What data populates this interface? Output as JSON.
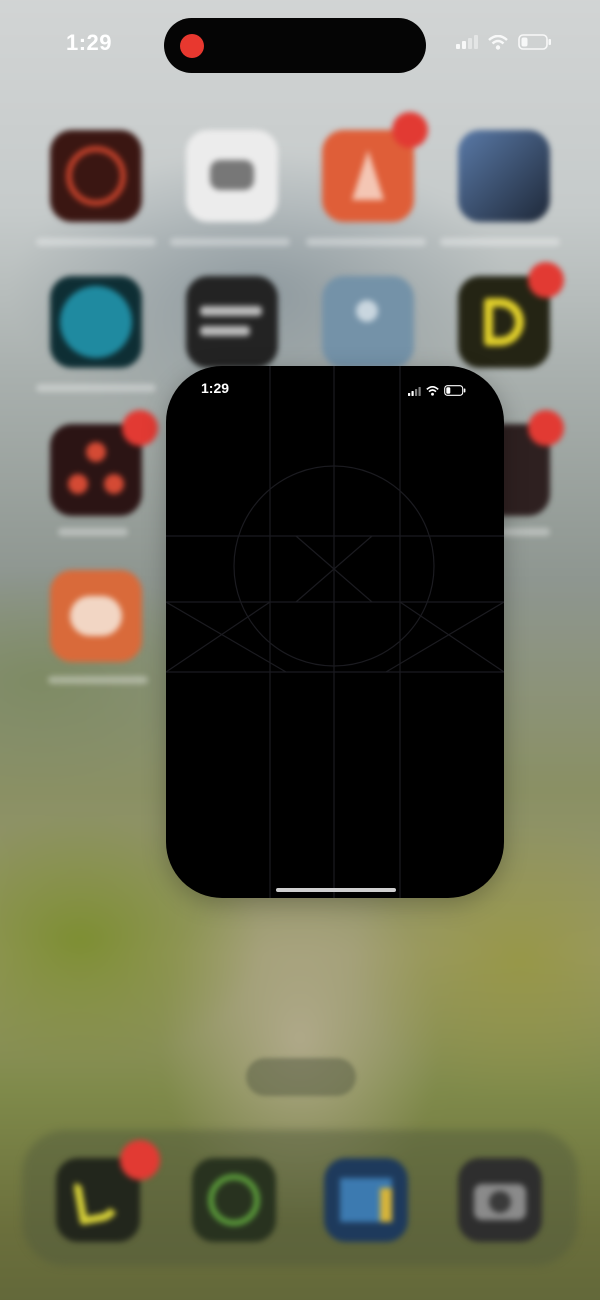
{
  "status_bar": {
    "time": "1:29",
    "icons": [
      "cellular-signal-icon",
      "wifi-icon",
      "battery-icon"
    ]
  },
  "dynamic_island": {
    "recording_indicator_color": "#e8382f"
  },
  "home_screen": {
    "app_icons": [
      {
        "name": "app-icon-red-radial",
        "color": "#8b2a20",
        "badge": false
      },
      {
        "name": "app-icon-white-bird",
        "color": "#e8e8e8",
        "badge": false
      },
      {
        "name": "app-icon-orange-a",
        "color": "#e0603a",
        "badge": true
      },
      {
        "name": "app-icon-game-cover",
        "color": "#3a4e6e",
        "badge": false
      },
      {
        "name": "app-icon-teal-circle",
        "color": "#1f7c90",
        "badge": false
      },
      {
        "name": "app-icon-dark-text",
        "color": "#2a2a2a",
        "badge": false
      },
      {
        "name": "app-icon-grey-blue",
        "color": "#7a98b0",
        "badge": false
      },
      {
        "name": "app-icon-yellow-d",
        "color": "#2a2a1a",
        "badge": true
      },
      {
        "name": "app-icon-red-nodes",
        "color": "#3a1a1a",
        "badge": true
      },
      {
        "name": "app-icon-dark-partial",
        "color": "#3a2a28",
        "badge": true
      },
      {
        "name": "app-icon-orange-hands",
        "color": "#d96a3a",
        "badge": false
      }
    ],
    "dock_apps": [
      {
        "name": "phone-app-icon",
        "color": "#2a2e22",
        "badge": true
      },
      {
        "name": "whatsapp-app-icon",
        "color": "#2e3a26",
        "badge": false
      },
      {
        "name": "files-app-icon",
        "color": "#2a4a6a",
        "badge": false
      },
      {
        "name": "camera-app-icon",
        "color": "#3a3a3a",
        "badge": false
      }
    ]
  },
  "pip_window": {
    "status_time": "1:29",
    "icons": [
      "cellular-signal-icon",
      "wifi-icon",
      "battery-icon"
    ]
  }
}
